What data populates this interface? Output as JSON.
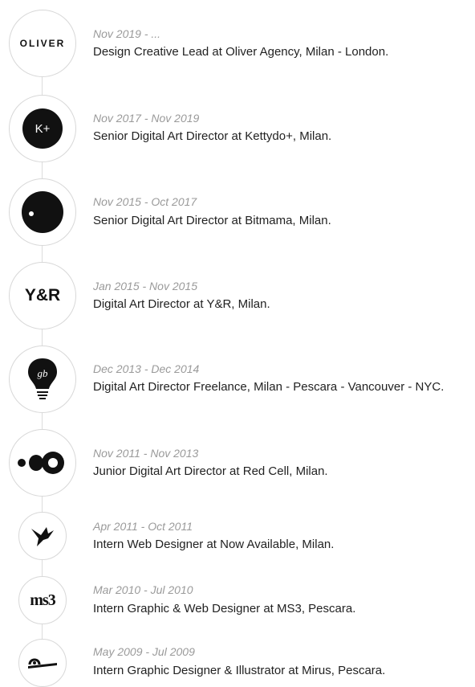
{
  "entries": [
    {
      "date": "Nov 2019 - ...",
      "role": "Design Creative Lead at Oliver Agency, Milan - London.",
      "logo": "oliver-logo",
      "logo_text": "OLIVER"
    },
    {
      "date": "Nov 2017 - Nov 2019",
      "role": "Senior Digital Art Director at Kettydo+, Milan.",
      "logo": "kettydo-logo",
      "logo_text": "K+"
    },
    {
      "date": "Nov 2015 - Oct 2017",
      "role": "Senior Digital Art Director at Bitmama, Milan.",
      "logo": "bitmama-logo"
    },
    {
      "date": "Jan 2015 - Nov 2015",
      "role": "Digital Art Director at Y&R, Milan.",
      "logo": "yr-logo",
      "logo_text": "Y&R"
    },
    {
      "date": "Dec 2013 - Dec 2014",
      "role": "Digital Art Director Freelance, Milan - Pescara - Vancouver - NYC.",
      "logo": "lightbulb-logo",
      "logo_text": "gb"
    },
    {
      "date": "Nov 2011 - Nov 2013",
      "role": "Junior Digital Art Director at Red Cell, Milan.",
      "logo": "redcell-logo"
    },
    {
      "date": "Apr 2011 - Oct 2011",
      "role": "Intern Web Designer at Now Available, Milan.",
      "logo": "now-available-logo"
    },
    {
      "date": "Mar 2010 - Jul 2010",
      "role": "Intern Graphic & Web Designer at MS3, Pescara.",
      "logo": "ms3-logo",
      "logo_text": "ms3"
    },
    {
      "date": "May 2009 - Jul 2009",
      "role": "Intern Graphic Designer & Illustrator at Mirus, Pescara.",
      "logo": "mirus-logo"
    }
  ]
}
